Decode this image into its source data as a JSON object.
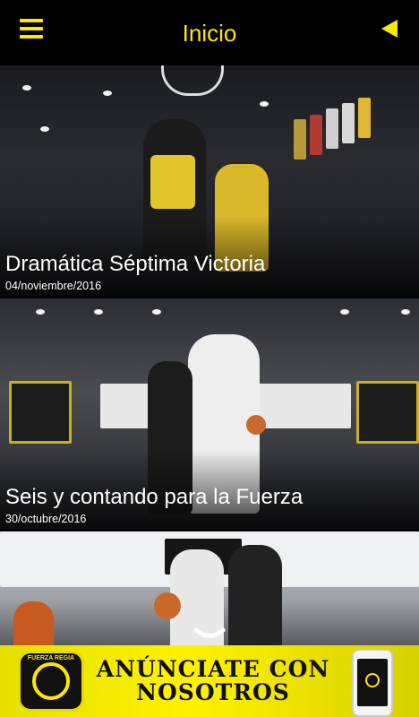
{
  "header": {
    "title": "Inicio",
    "menu_icon": "hamburger-menu-icon",
    "back_icon": "back-triangle-icon"
  },
  "news": [
    {
      "title": "Dramática Séptima Victoria",
      "date": "04/noviembre/2016"
    },
    {
      "title": "Seis y contando para la Fuerza",
      "date": "30/octubre/2016"
    }
  ],
  "ad": {
    "line1": "ANÚNCIATE CON",
    "line2": "NOSOTROS",
    "logo_text": "FUERZA REGIA"
  },
  "colors": {
    "accent": "#ffe600",
    "background": "#000000"
  }
}
